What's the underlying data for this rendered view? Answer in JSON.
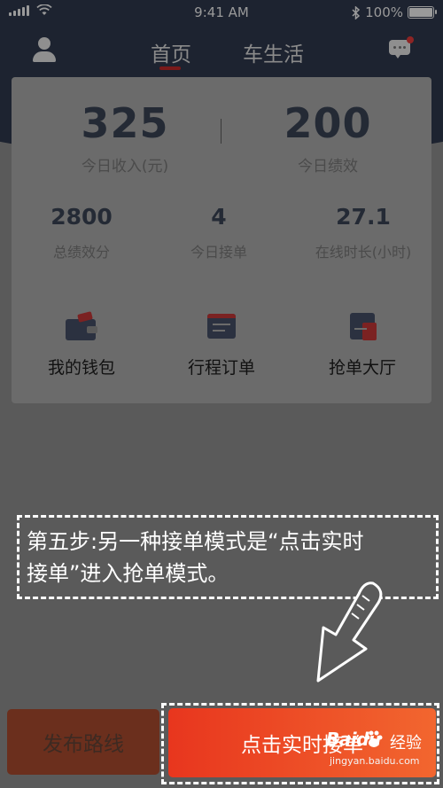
{
  "status_bar": {
    "time": "9:41 AM",
    "battery": "100%"
  },
  "nav": {
    "tabs": [
      "首页",
      "车生活"
    ]
  },
  "stats_main": [
    {
      "value": "325",
      "label": "今日收入(元)"
    },
    {
      "value": "200",
      "label": "今日绩效"
    }
  ],
  "stats_secondary": [
    {
      "value": "2800",
      "label": "总绩效分"
    },
    {
      "value": "4",
      "label": "今日接单"
    },
    {
      "value": "27.1",
      "label": "在线时长(小时)"
    }
  ],
  "actions": [
    {
      "label": "我的钱包",
      "icon": "wallet-icon"
    },
    {
      "label": "行程订单",
      "icon": "order-icon"
    },
    {
      "label": "抢单大厅",
      "icon": "grab-hall-icon"
    }
  ],
  "annotation": {
    "line1": "第五步:另一种接单模式是“点击实时",
    "line2": "接单”进入抢单模式。"
  },
  "buttons": {
    "publish_route": "发布路线",
    "realtime_accept": "点击实时接单"
  },
  "watermark": {
    "brand": "Baidu",
    "text": "经验",
    "url": "jingyan.baidu.com"
  },
  "colors": {
    "header_bg": "#1d2330",
    "accent_red": "#7b2222",
    "realtime_gradient_start": "#e8361e",
    "realtime_gradient_end": "#f2662f",
    "overlay": "#5a5a5a"
  }
}
